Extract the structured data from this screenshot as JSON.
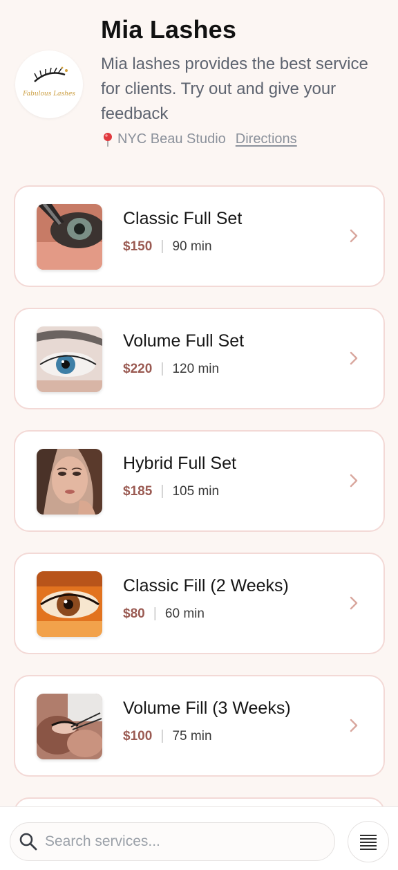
{
  "business": {
    "name": "Mia Lashes",
    "description": "Mia lashes provides the best service for clients. Try out and give your feedback",
    "location": "NYC Beau Studio",
    "directions_label": "Directions",
    "logo_text": "Fabulous Lashes"
  },
  "services": [
    {
      "name": "Classic Full Set",
      "price": "$150",
      "duration": "90 min",
      "image": "eye-closeup-application"
    },
    {
      "name": "Volume Full Set",
      "price": "$220",
      "duration": "120 min",
      "image": "blue-eye-closeup"
    },
    {
      "name": "Hybrid Full Set",
      "price": "$185",
      "duration": "105 min",
      "image": "woman-portrait"
    },
    {
      "name": "Classic Fill (2 Weeks)",
      "price": "$80",
      "duration": "60 min",
      "image": "brown-eye-closeup"
    },
    {
      "name": "Volume Fill (3 Weeks)",
      "price": "$100",
      "duration": "75 min",
      "image": "lash-tweezers"
    }
  ],
  "search": {
    "placeholder": "Search services..."
  },
  "colors": {
    "background": "#fcf6f3",
    "card_border": "#f3d9d6",
    "price": "#9a5a52",
    "chevron": "#d9a79e",
    "muted_text": "#8b919b"
  },
  "icons": {
    "location": "pin-icon",
    "chevron": "chevron-right-icon",
    "search": "search-icon",
    "menu": "menu-lines-icon"
  }
}
